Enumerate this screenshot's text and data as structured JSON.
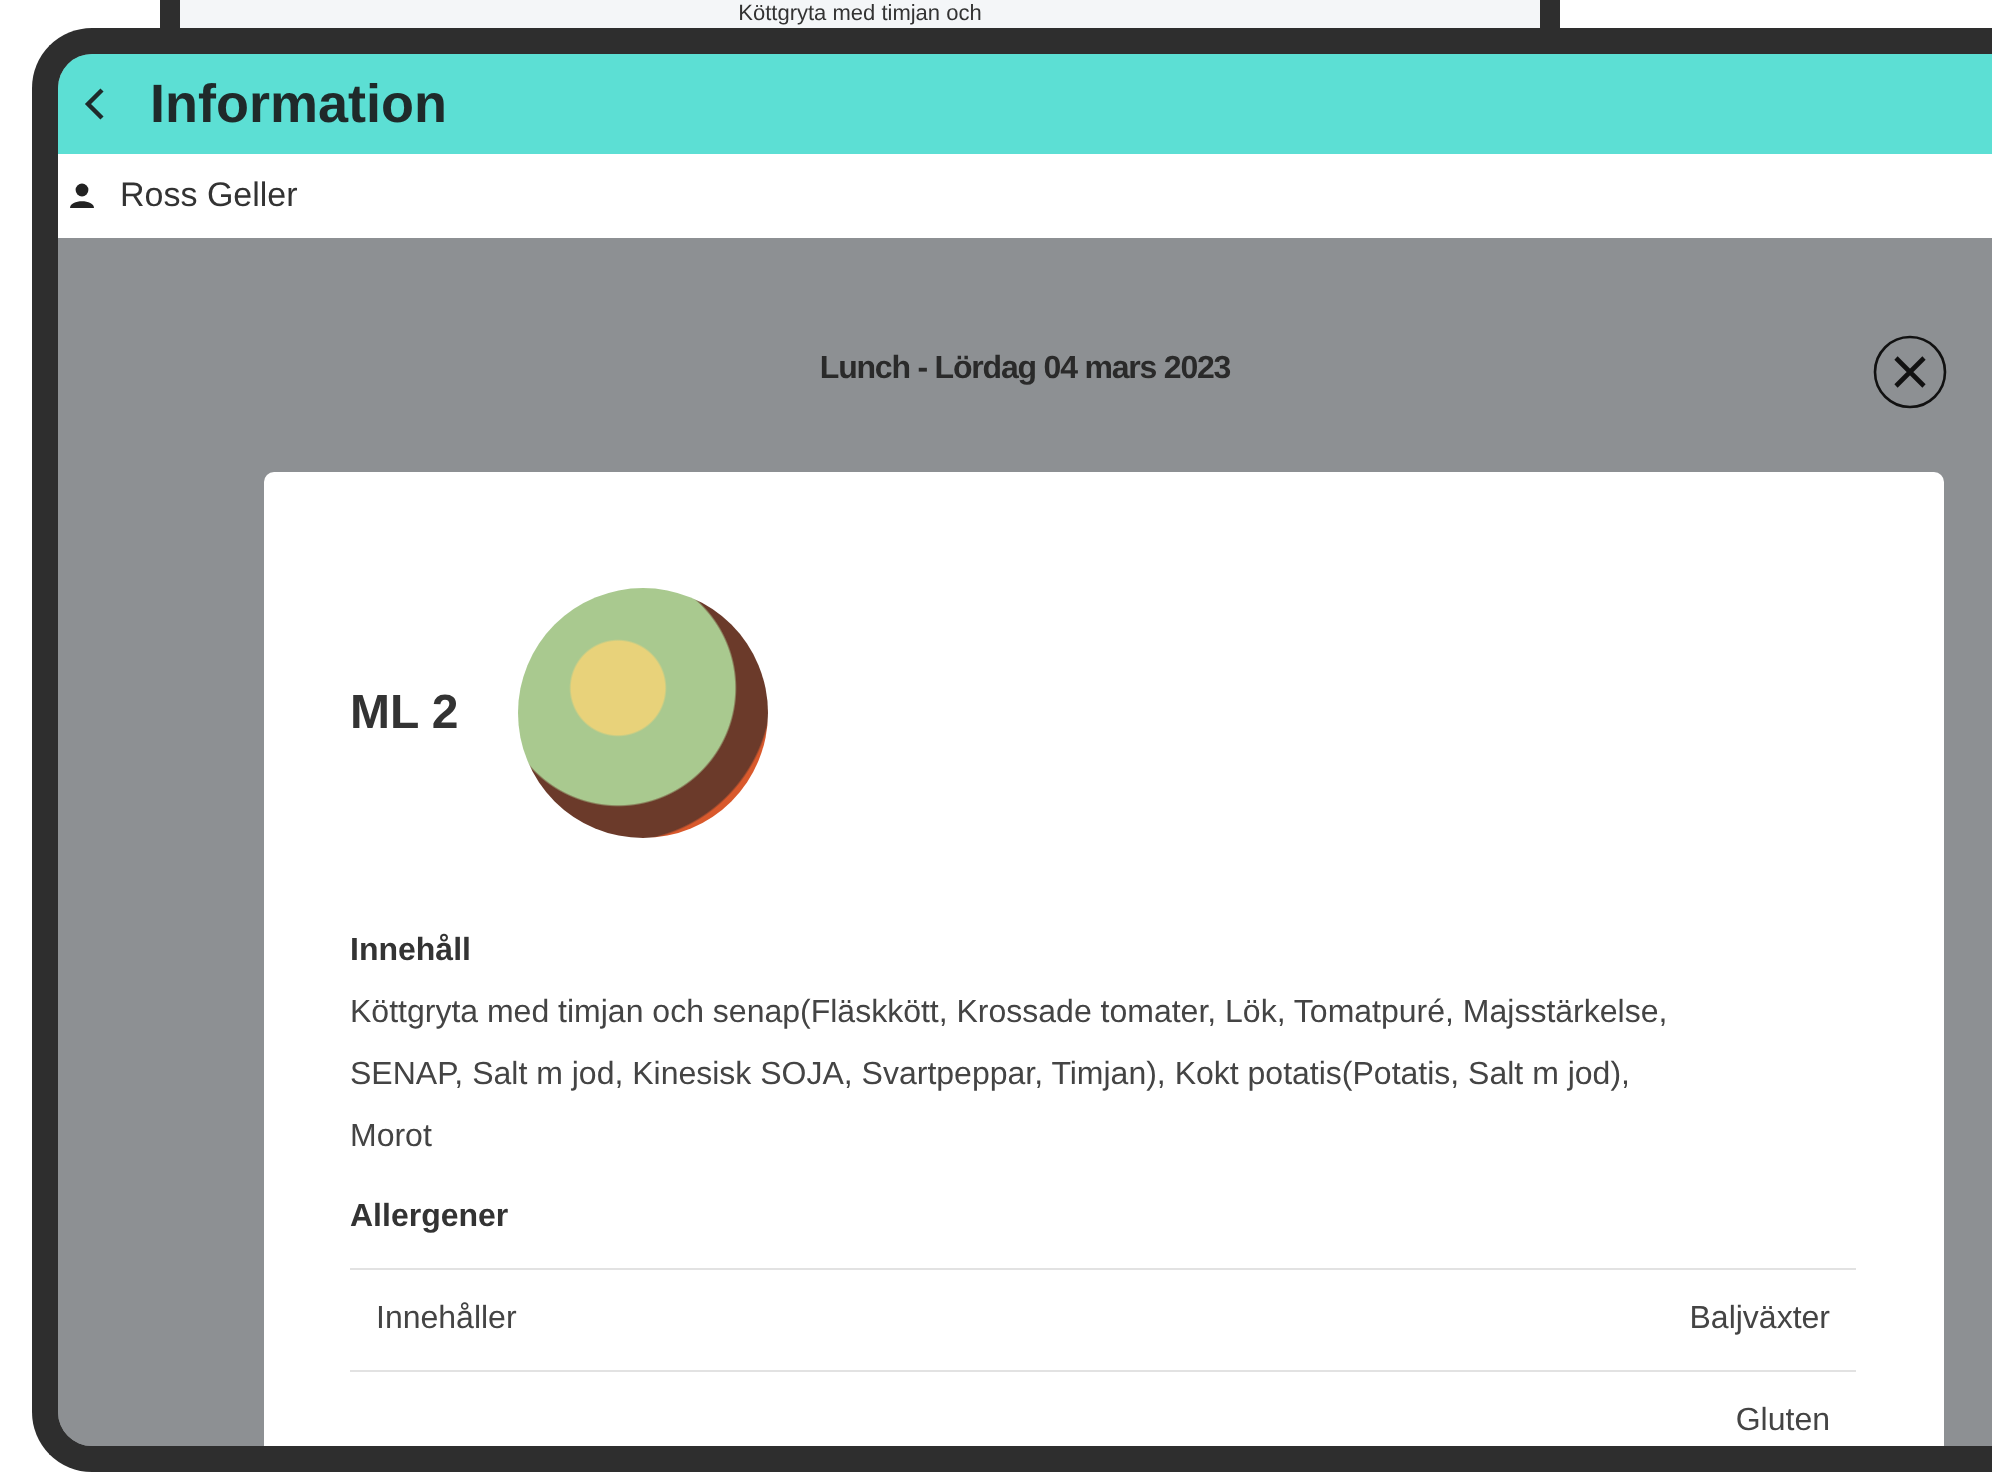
{
  "background": {
    "text": "Köttgryta med timjan och"
  },
  "header": {
    "title": "Information"
  },
  "user": {
    "name": "Ross Geller"
  },
  "dialog": {
    "title": "Lunch - Lördag 04 mars 2023",
    "dish": {
      "name": "ML 2",
      "contents_heading": "Innehåll",
      "contents": "Köttgryta med timjan och senap(Fläskkött, Krossade tomater, Lök, Tomatpuré, Majsstärkelse, SENAP, Salt m jod, Kinesisk SOJA, Svartpeppar, Timjan), Kokt potatis(Potatis, Salt m jod), Morot",
      "allergens_heading": "Allergener",
      "allergens": [
        {
          "label": "Innehåller",
          "value": "Baljväxter"
        },
        {
          "value": "Gluten"
        }
      ]
    }
  }
}
